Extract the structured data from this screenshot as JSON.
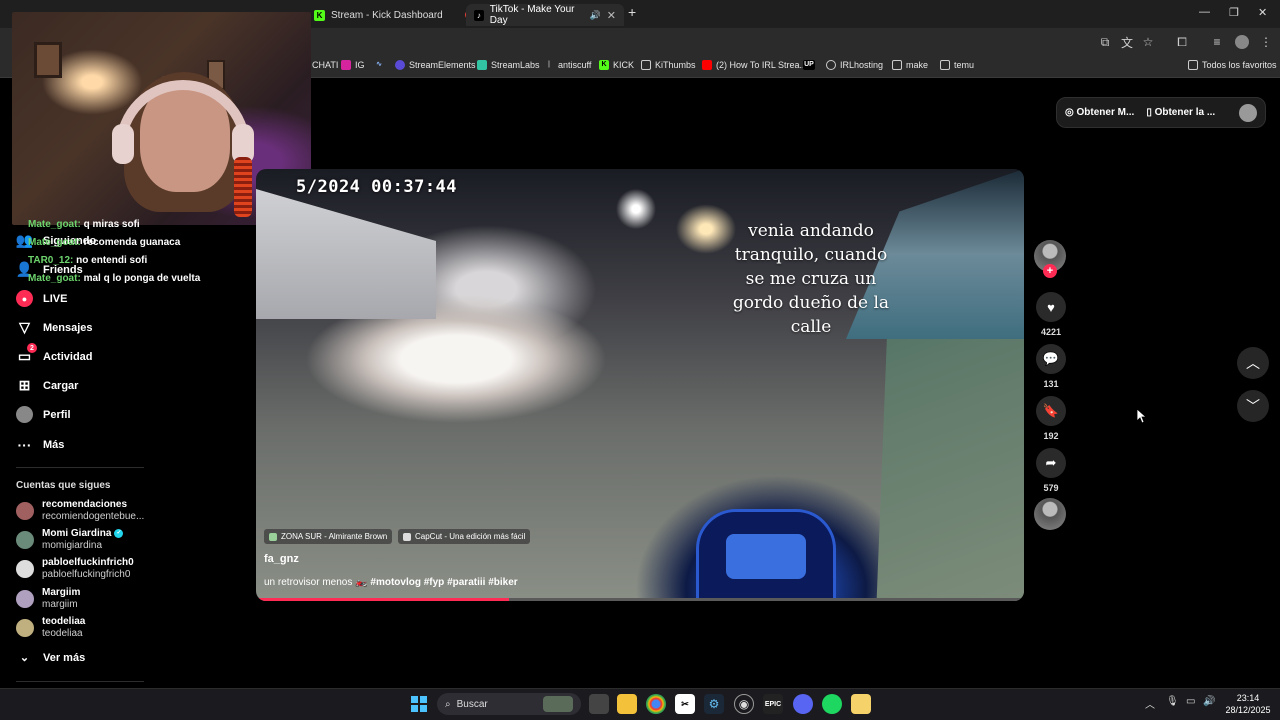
{
  "browser": {
    "tabs": [
      {
        "label": "Stream - Kick Dashboard",
        "color": "#53fc18"
      },
      {
        "label": "TikTok - Make Your Day",
        "active": true
      }
    ],
    "bookmarks": [
      "CHATI",
      "IG",
      "StreamElements",
      "StreamLabs",
      "antiscuff",
      "KICK",
      "KiThumbs",
      "(2) How To IRL Strea...",
      "IRLhosting",
      "make",
      "temu"
    ],
    "bookmarks_all": "Todos los favoritos"
  },
  "chat": [
    {
      "name": "Mate_goat:",
      "text": "q miras sofi"
    },
    {
      "name": "Mate_goat:",
      "text": "recomenda guanaca"
    },
    {
      "name": "TAR0_12:",
      "text": "no entendi sofi"
    },
    {
      "name": "Mate_goat:",
      "text": "mal q lo ponga de vuelta"
    }
  ],
  "sidebar": {
    "nav": [
      {
        "label": "Siguiendo",
        "icon": "following-icon"
      },
      {
        "label": "Friends",
        "icon": "friends-icon"
      },
      {
        "label": "LIVE",
        "icon": "live-icon"
      },
      {
        "label": "Mensajes",
        "icon": "messages-icon"
      },
      {
        "label": "Actividad",
        "icon": "activity-icon",
        "badge": "2"
      },
      {
        "label": "Cargar",
        "icon": "upload-icon"
      },
      {
        "label": "Perfil",
        "icon": "profile-icon"
      },
      {
        "label": "Más",
        "icon": "more-icon"
      }
    ],
    "following_title": "Cuentas que sigues",
    "accounts": [
      {
        "name": "recomendaciones",
        "user": "recomiendogentebue..."
      },
      {
        "name": "Momi Giardina",
        "user": "momigiardina",
        "verified": true
      },
      {
        "name": "pabloelfuckinfrich0",
        "user": "pabloelfuckingfrich0"
      },
      {
        "name": "Margiim",
        "user": "margiim"
      },
      {
        "name": "teodeliaa",
        "user": "teodeliaa"
      }
    ],
    "see_more": "Ver más"
  },
  "top_pill": {
    "btn1": "Obtener M...",
    "btn2": "Obtener la ..."
  },
  "video": {
    "timestamp": "5/2024   00:37:44",
    "overlay_lines": [
      "venia andando",
      "tranquilo, cuando",
      "se me cruza un",
      "gordo dueño de la",
      "calle"
    ],
    "location_chip": "ZONA SUR - Almirante Brown",
    "capcut_chip": "CapCut - Una edición más fácil",
    "author": "fa_gnz",
    "description": "un retrovisor menos 🏍️",
    "hashtags": "#motovlog #fyp #paratiii #biker",
    "progress": 0.33
  },
  "actions": {
    "likes": "4221",
    "comments": "131",
    "saves": "192",
    "shares": "579"
  },
  "taskbar": {
    "search": "Buscar",
    "time": "23:14",
    "date": "28/12/2025"
  },
  "colors": {
    "accent": "#fe2c55",
    "kick": "#53fc18"
  }
}
